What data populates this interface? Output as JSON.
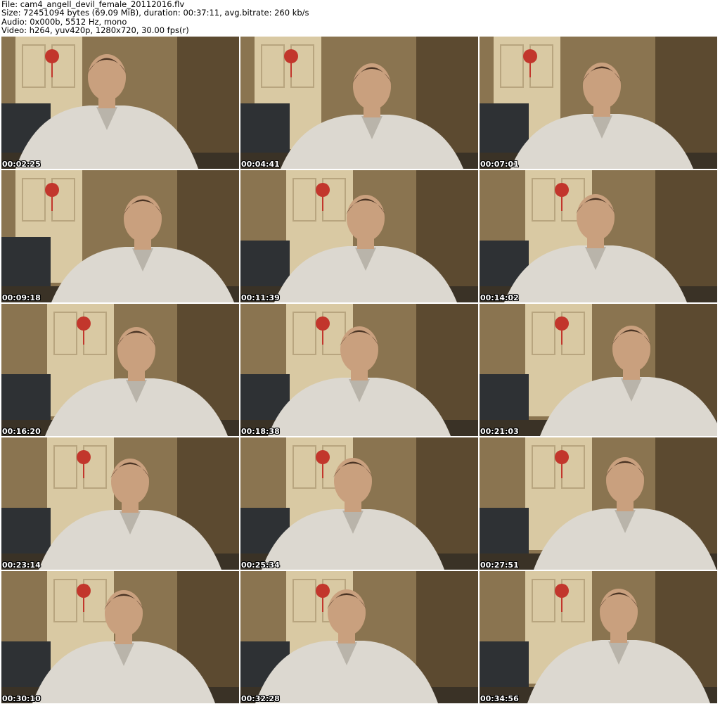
{
  "header": {
    "file_line": "File: cam4_angell_devil_female_20112016.flv",
    "size_line": "Size: 72451094 bytes (69.09 MiB), duration: 00:37:11, avg.bitrate: 260 kb/s",
    "audio_line": "Audio: 0x000b, 5512 Hz, mono",
    "video_line": "Video: h264, yuv420p, 1280x720, 30.00 fps(r)"
  },
  "thumbnails": [
    {
      "timestamp": "00:02:25"
    },
    {
      "timestamp": "00:04:41"
    },
    {
      "timestamp": "00:07:01"
    },
    {
      "timestamp": "00:09:18"
    },
    {
      "timestamp": "00:11:39"
    },
    {
      "timestamp": "00:14:02"
    },
    {
      "timestamp": "00:16:20"
    },
    {
      "timestamp": "00:18:38"
    },
    {
      "timestamp": "00:21:03"
    },
    {
      "timestamp": "00:23:14"
    },
    {
      "timestamp": "00:25:34"
    },
    {
      "timestamp": "00:27:51"
    },
    {
      "timestamp": "00:30:10"
    },
    {
      "timestamp": "00:32:28"
    },
    {
      "timestamp": "00:34:56"
    }
  ],
  "colors": {
    "wall": "#8a7450",
    "door": "#d9c9a3",
    "sweater": "#dcd8d0",
    "skin": "#c9a07e",
    "hair": "#4a3424",
    "couch": "#2e3134"
  }
}
